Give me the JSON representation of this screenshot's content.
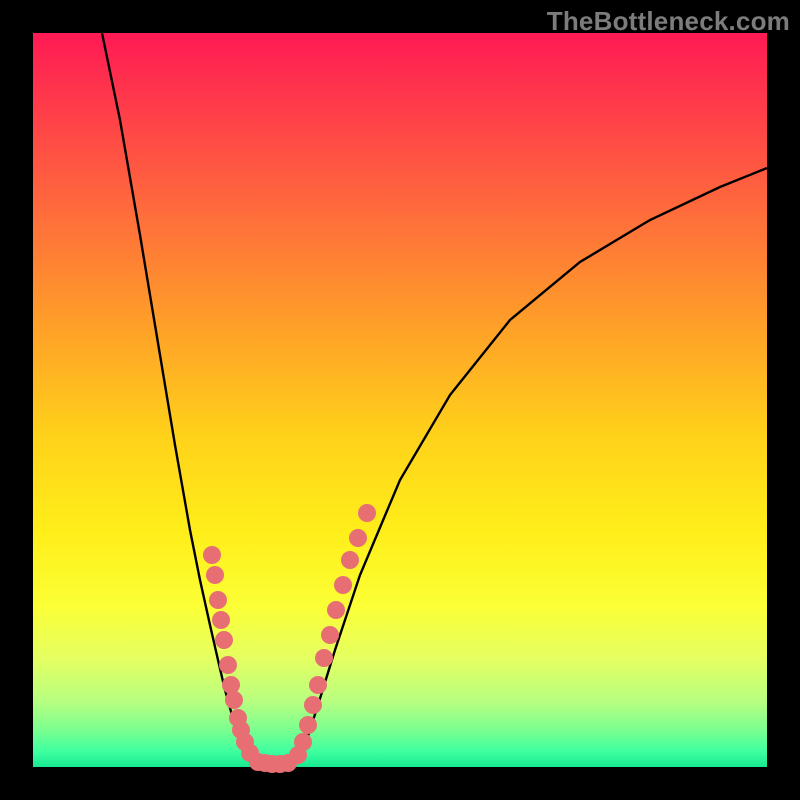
{
  "watermark": "TheBottleneck.com",
  "colors": {
    "frame": "#000000",
    "curve": "#000000",
    "dot_fill": "#e76f73",
    "dot_stroke": "#c5454a"
  },
  "chart_data": {
    "type": "line",
    "title": "",
    "xlabel": "",
    "ylabel": "",
    "xlim": [
      33,
      767
    ],
    "ylim": [
      33,
      767
    ],
    "series": [
      {
        "name": "left-curve",
        "x": [
          102,
          120,
          140,
          160,
          175,
          190,
          200,
          210,
          218,
          225,
          232,
          238,
          244,
          250,
          256
        ],
        "y": [
          33,
          120,
          235,
          355,
          445,
          530,
          580,
          625,
          660,
          690,
          715,
          735,
          750,
          760,
          765
        ]
      },
      {
        "name": "valley",
        "x": [
          256,
          265,
          275,
          285,
          295
        ],
        "y": [
          765,
          766,
          766,
          766,
          765
        ]
      },
      {
        "name": "right-curve",
        "x": [
          295,
          305,
          318,
          335,
          360,
          400,
          450,
          510,
          580,
          650,
          720,
          767
        ],
        "y": [
          765,
          745,
          705,
          650,
          575,
          480,
          395,
          320,
          262,
          220,
          187,
          168
        ]
      }
    ],
    "dots_left": [
      {
        "x": 212,
        "y": 555
      },
      {
        "x": 215,
        "y": 575
      },
      {
        "x": 218,
        "y": 600
      },
      {
        "x": 221,
        "y": 620
      },
      {
        "x": 224,
        "y": 640
      },
      {
        "x": 228,
        "y": 665
      },
      {
        "x": 231,
        "y": 685
      },
      {
        "x": 234,
        "y": 700
      },
      {
        "x": 238,
        "y": 718
      },
      {
        "x": 241,
        "y": 730
      },
      {
        "x": 245,
        "y": 742
      },
      {
        "x": 250,
        "y": 753
      }
    ],
    "dots_valley": [
      {
        "x": 258,
        "y": 762
      },
      {
        "x": 265,
        "y": 763
      },
      {
        "x": 272,
        "y": 764
      },
      {
        "x": 280,
        "y": 764
      },
      {
        "x": 288,
        "y": 763
      }
    ],
    "dots_right": [
      {
        "x": 298,
        "y": 755
      },
      {
        "x": 303,
        "y": 742
      },
      {
        "x": 308,
        "y": 725
      },
      {
        "x": 313,
        "y": 705
      },
      {
        "x": 318,
        "y": 685
      },
      {
        "x": 324,
        "y": 658
      },
      {
        "x": 330,
        "y": 635
      },
      {
        "x": 336,
        "y": 610
      },
      {
        "x": 343,
        "y": 585
      },
      {
        "x": 350,
        "y": 560
      },
      {
        "x": 358,
        "y": 538
      },
      {
        "x": 367,
        "y": 513
      }
    ]
  }
}
